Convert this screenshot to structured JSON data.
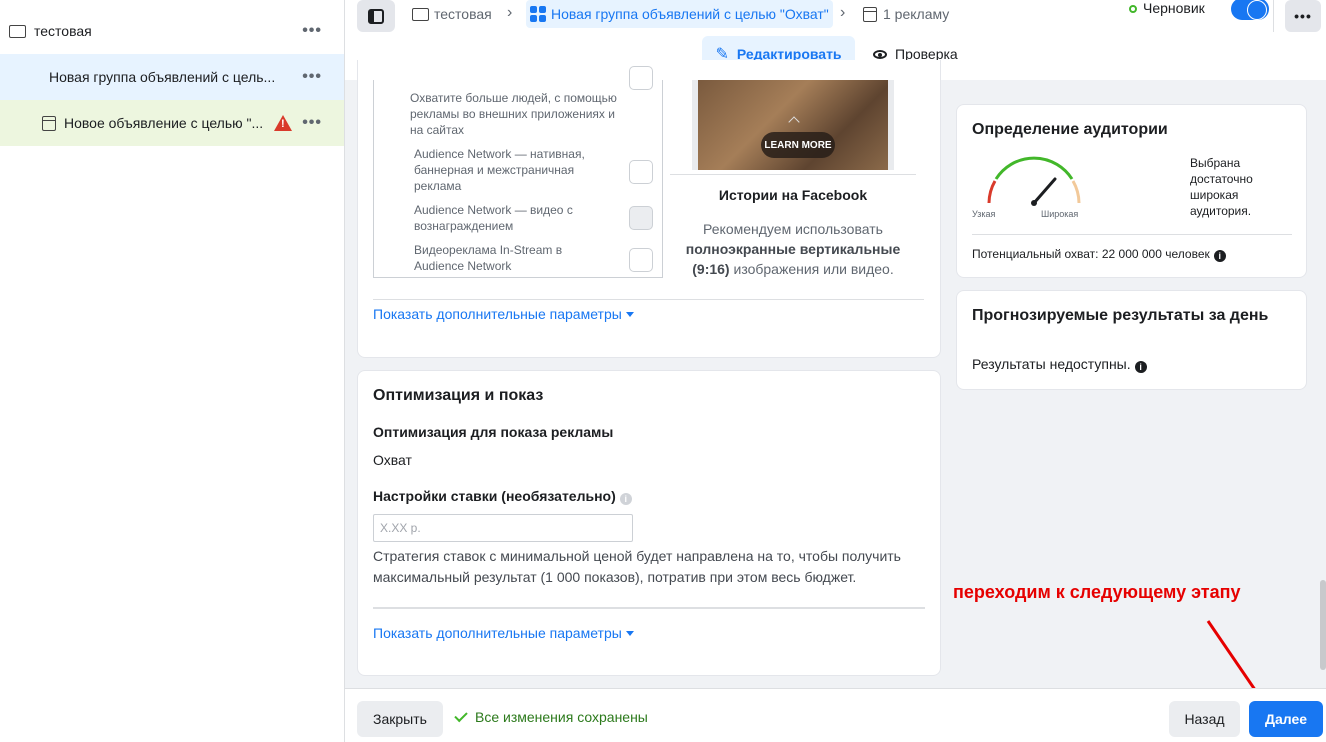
{
  "sidebar": {
    "campaign": "тестовая",
    "adset": "Новая группа объявлений с цель...",
    "ad": "Новое объявление с целью \"..."
  },
  "topbar": {
    "crumb_campaign": "тестовая",
    "crumb_adset": "Новая группа объявлений с целью \"Охват\"",
    "crumb_ad": "1 рекламу",
    "status": "Черновик",
    "edit": "Редактировать",
    "review": "Проверка"
  },
  "placements": {
    "an_description": "Охватите больше людей, с помощью рекламы во внешних приложениях и на сайтах",
    "items": [
      "Audience Network — нативная, баннерная и межстраничная реклама",
      "Audience Network — видео с вознаграждением",
      "Видеореклама In-Stream в Audience Network"
    ],
    "more": "Показать дополнительные параметры",
    "preview": {
      "cta": "LEARN MORE",
      "title": "Истории на Facebook",
      "rec_pre": "Рекомендуем использовать",
      "rec_bold": "полноэкранные вертикальные",
      "rec_ratio": "(9:16)",
      "rec_post": "изображения или видео."
    }
  },
  "optimization": {
    "title": "Оптимизация и показ",
    "opt_label": "Оптимизация для показа рекламы",
    "opt_value": "Охват",
    "bid_label": "Настройки ставки (необязательно)",
    "bid_placeholder": "X.XX р.",
    "strategy": "Стратегия ставок с минимальной ценой будет направлена на то, чтобы получить максимальный результат (1 000 показов), потратив при этом весь бюджет.",
    "more": "Показать дополнительные параметры"
  },
  "audience": {
    "title": "Определение аудитории",
    "narrow": "Узкая",
    "broad": "Широкая",
    "verdict": "Выбрана достаточно широкая аудитория.",
    "reach": "Потенциальный охват: 22 000 000 человек"
  },
  "forecast": {
    "title": "Прогнозируемые результаты за день",
    "text": "Результаты недоступны."
  },
  "footer": {
    "close": "Закрыть",
    "saved": "Все изменения сохранены",
    "back": "Назад",
    "next": "Далее"
  },
  "annotation": "переходим к следующему этапу",
  "colors": {
    "accent": "#1877f2",
    "annotation": "#e60000",
    "ok": "#42b72a"
  }
}
